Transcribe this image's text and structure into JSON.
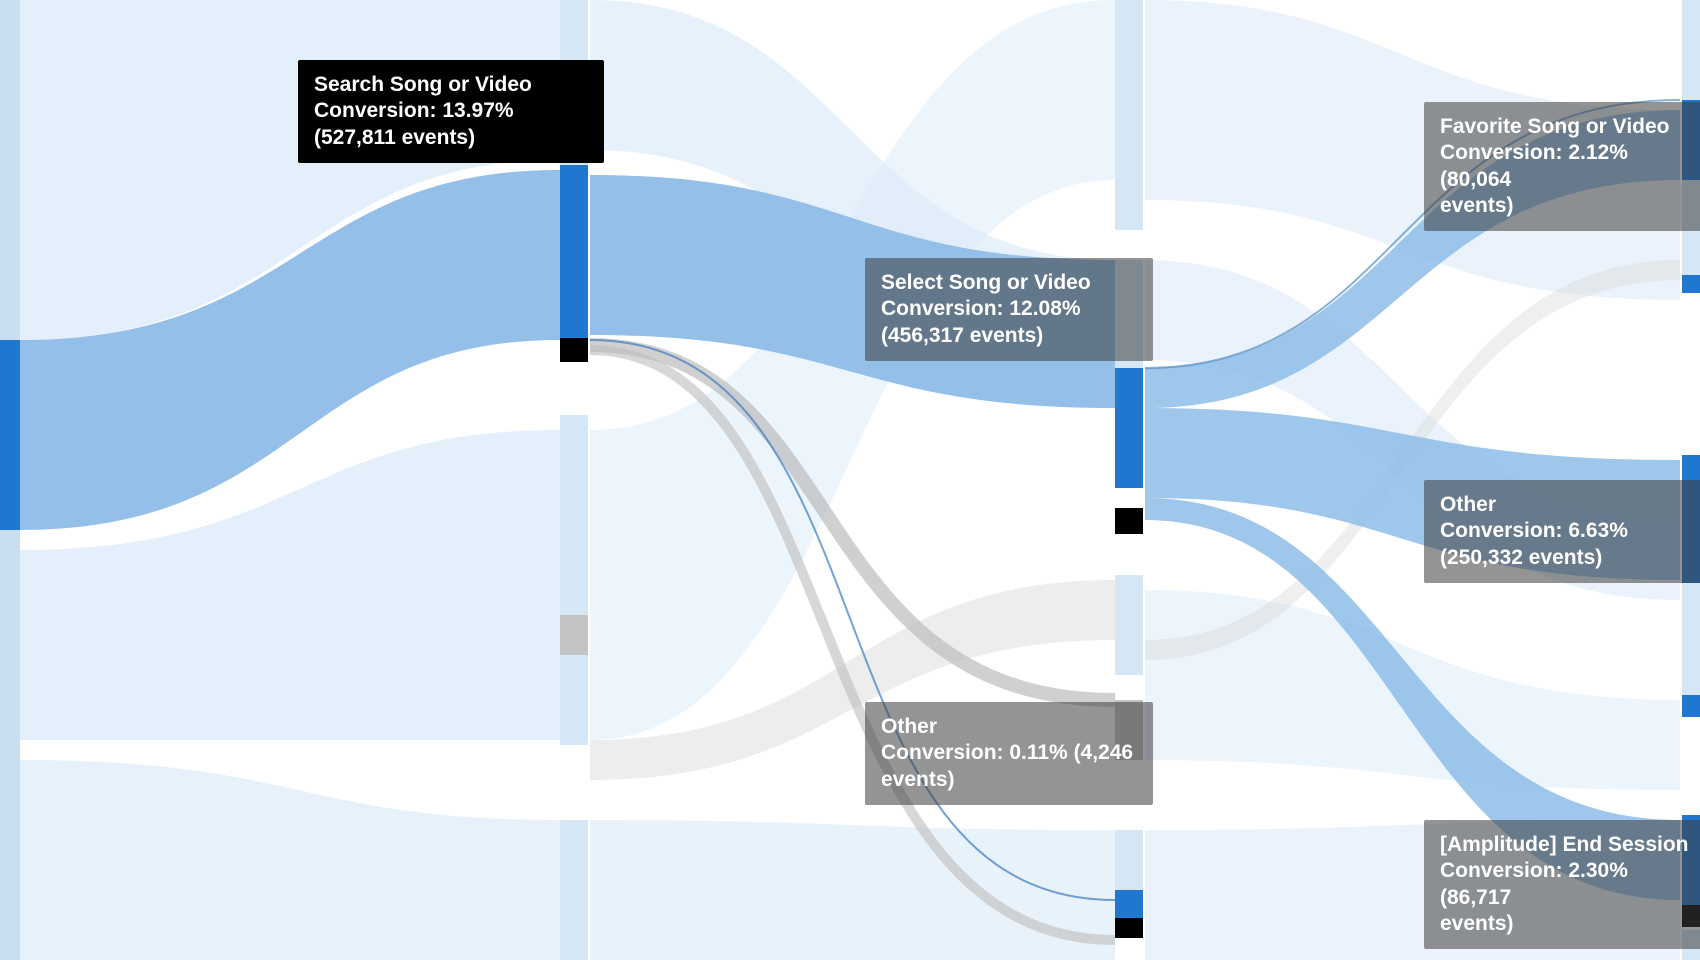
{
  "chart_data": {
    "type": "sankey",
    "title": "",
    "columns": 4,
    "nodes": [
      {
        "id": "n0_start",
        "col": 0,
        "label": "",
        "conversion_pct": null,
        "events": null,
        "tooltip_style": null,
        "selected": true
      },
      {
        "id": "n1_search",
        "col": 1,
        "label": "Search Song or Video",
        "conversion_pct": 13.97,
        "events": 527811,
        "tooltip_style": "dark",
        "selected": true
      },
      {
        "id": "n2_select",
        "col": 2,
        "label": "Select Song or Video",
        "conversion_pct": 12.08,
        "events": 456317,
        "tooltip_style": "grey",
        "selected": true
      },
      {
        "id": "n2_other",
        "col": 2,
        "label": "Other",
        "conversion_pct": 0.11,
        "events": 4246,
        "tooltip_style": "grey",
        "selected": false
      },
      {
        "id": "n3_favorite",
        "col": 3,
        "label": "Favorite Song or Video",
        "conversion_pct": 2.12,
        "events": 80064,
        "tooltip_style": "grey",
        "selected": false
      },
      {
        "id": "n3_other",
        "col": 3,
        "label": "Other",
        "conversion_pct": 6.63,
        "events": 250332,
        "tooltip_style": "grey",
        "selected": false
      },
      {
        "id": "n3_end",
        "col": 3,
        "label": "[Amplitude] End Session",
        "conversion_pct": 2.3,
        "events": 86717,
        "tooltip_style": "grey",
        "selected": false
      }
    ],
    "links": [
      {
        "from": "n0_start",
        "to": "n1_search",
        "weight": 527811,
        "highlight": true
      },
      {
        "from": "n1_search",
        "to": "n2_select",
        "weight": 456317,
        "highlight": true
      },
      {
        "from": "n1_search",
        "to": "n2_other",
        "weight": 4246,
        "highlight": false
      },
      {
        "from": "n2_select",
        "to": "n3_favorite",
        "weight": 80064,
        "highlight": true
      },
      {
        "from": "n2_select",
        "to": "n3_other",
        "weight": 250332,
        "highlight": true
      },
      {
        "from": "n2_select",
        "to": "n3_end",
        "weight": 86717,
        "highlight": true
      }
    ],
    "colors": {
      "flow_highlight": "#8ebce8",
      "flow_faint": "#dcebf9",
      "flow_grey": "#d7d7d7",
      "node_selected": "#1f77d0",
      "node_grey": "#bfbfbf",
      "node_black": "#000000"
    }
  },
  "tooltips": {
    "search": {
      "title": "Search Song or Video",
      "line2": "Conversion: 13.97%",
      "line3": "(527,811 events)"
    },
    "select": {
      "title": "Select Song or Video",
      "line2": "Conversion: 12.08%",
      "line3": "(456,317 events)"
    },
    "other2": {
      "title": "Other",
      "line2": "Conversion: 0.11% (4,246",
      "line3": "events)"
    },
    "favorite": {
      "title": "Favorite Song or Video",
      "line2": "Conversion: 2.12% (80,064",
      "line3": "events)"
    },
    "other3": {
      "title": "Other",
      "line2": "Conversion: 6.63%",
      "line3": "(250,332 events)"
    },
    "end": {
      "title": "[Amplitude] End Session",
      "line2": "Conversion: 2.30% (86,717",
      "line3": "events)"
    }
  }
}
